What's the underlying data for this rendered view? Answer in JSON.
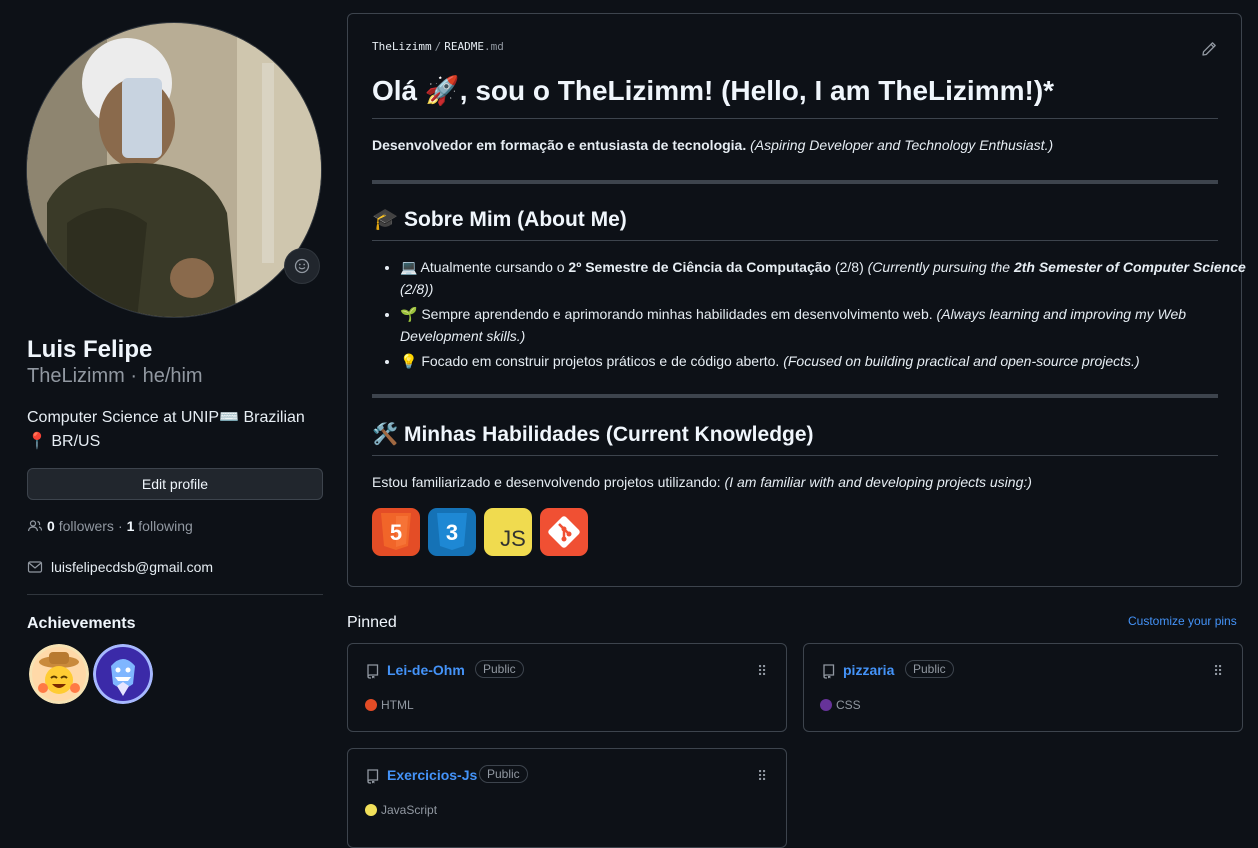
{
  "profile": {
    "full_name": "Luis Felipe",
    "login_line": "TheLizimm · he/him",
    "bio": "Computer Science at UNIP⌨️ Brazilian 📍 BR/US",
    "edit_label": "Edit profile",
    "followers_count": "0",
    "followers_label": "followers",
    "sep": "·",
    "following_count": "1",
    "following_label": "following",
    "email": "luisfelipecdsb@gmail.com",
    "achievements_title": "Achievements"
  },
  "readme": {
    "owner": "TheLizimm",
    "slash": "/",
    "file": "README",
    "ext": ".md",
    "title": "Olá 🚀, sou o TheLizimm! (Hello, I am TheLizimm!)*",
    "intro_bold": "Desenvolvedor em formação e entusiasta de tecnologia.",
    "intro_italic": "(Aspiring Developer and Technology Enthusiast.)",
    "about_heading": "🎓 Sobre Mim (About Me)",
    "about_items": [
      {
        "pre": "💻 Atualmente cursando o ",
        "bold": "2º Semestre de Ciência da Computação",
        "mid": " (2/8) ",
        "it_pre": "(Currently pursuing the ",
        "it_bold": "2th Semester of Computer Science",
        "it_post": " (2/8))"
      },
      {
        "pre": "🌱 Sempre aprendendo e aprimorando minhas habilidades em desenvolvimento web. ",
        "italic": "(Always learning and improving my Web Development skills.)"
      },
      {
        "pre": "💡 Focado em construir projetos práticos e de código aberto. ",
        "italic": "(Focused on building practical and open-source projects.)"
      }
    ],
    "skills_heading": "🛠️ Minhas Habilidades (Current Knowledge)",
    "skills_text": "Estou familiarizado e desenvolvendo projetos utilizando: ",
    "skills_italic": "(I am familiar with and developing projects using:)",
    "tech": [
      {
        "name": "html5",
        "label": "5",
        "color": "#e44d26"
      },
      {
        "name": "css3",
        "label": "3",
        "color": "#1572b6"
      },
      {
        "name": "javascript",
        "label": "JS",
        "color": "#f0db4f"
      },
      {
        "name": "git",
        "label": "",
        "color": "#f05033"
      }
    ]
  },
  "pinned": {
    "title": "Pinned",
    "customize": "Customize your pins",
    "repos": [
      {
        "name": "Lei-de-Ohm",
        "visibility": "Public",
        "lang": "HTML",
        "lang_color": "#e34c26"
      },
      {
        "name": "pizzaria",
        "visibility": "Public",
        "lang": "CSS",
        "lang_color": "#663399"
      },
      {
        "name": "Exercicios-Js",
        "visibility": "Public",
        "lang": "JavaScript",
        "lang_color": "#f1e05a"
      }
    ]
  }
}
